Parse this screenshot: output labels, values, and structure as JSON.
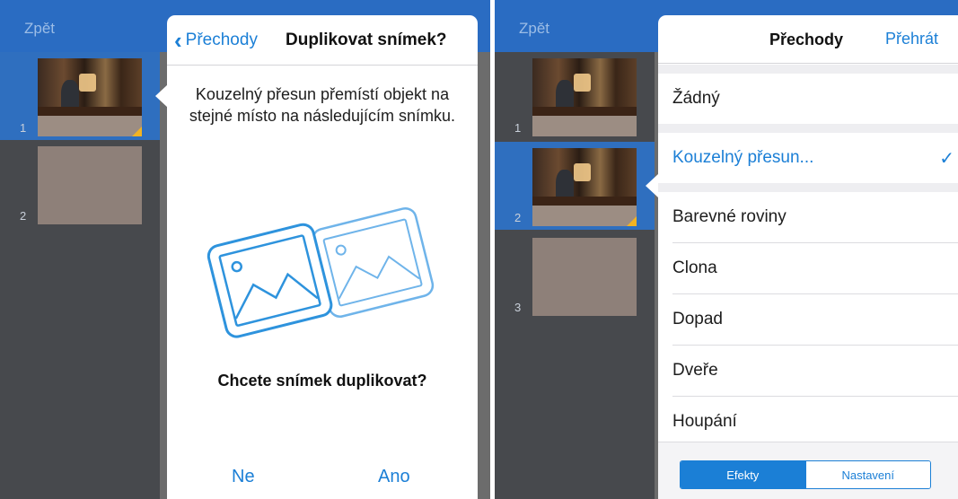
{
  "left_screen": {
    "back_label": "Zpět",
    "thumbnails": [
      {
        "number": "1",
        "selected": true
      },
      {
        "number": "2",
        "selected": false
      }
    ],
    "popover": {
      "back_label": "Přechody",
      "title": "Duplikovat snímek?",
      "description": "Kouzelný přesun přemístí objekt na stejné místo na následujícím snímku.",
      "question": "Chcete snímek duplikovat?",
      "no_label": "Ne",
      "yes_label": "Ano"
    }
  },
  "right_screen": {
    "back_label": "Zpět",
    "thumbnails": [
      {
        "number": "1",
        "selected": false
      },
      {
        "number": "2",
        "selected": true
      },
      {
        "number": "3",
        "selected": false
      }
    ],
    "popover": {
      "title": "Přechody",
      "play_label": "Přehrát",
      "none_option": "Žádný",
      "selected_option": "Kouzelný přesun...",
      "options": [
        "Barevné roviny",
        "Clona",
        "Dopad",
        "Dveře",
        "Houpání"
      ],
      "tabs": [
        {
          "label": "Efekty",
          "active": true
        },
        {
          "label": "Nastavení",
          "active": false
        }
      ]
    }
  },
  "colors": {
    "accent_blue": "#1b7fd6",
    "topbar_blue": "#2a6cc2",
    "selection_blue": "#2f6fbf",
    "badge_yellow": "#f2b322"
  },
  "icons": {
    "back": "chevron-left-icon",
    "selected_check": "checkmark-icon",
    "illustration": "duplicate-slide-icon"
  }
}
